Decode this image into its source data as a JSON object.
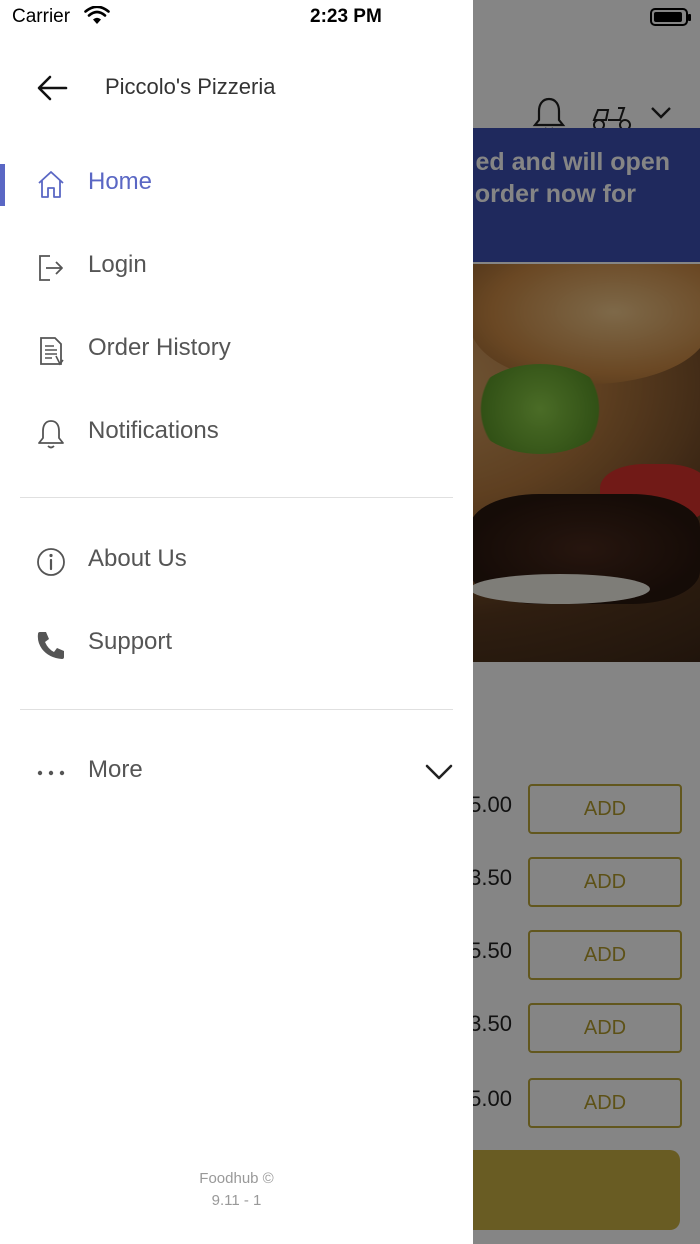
{
  "status_bar": {
    "carrier": "Carrier",
    "time": "2:23 PM"
  },
  "drawer": {
    "title": "Piccolo's Pizzeria",
    "items": [
      {
        "label": "Home",
        "icon": "home-icon",
        "active": true
      },
      {
        "label": "Login",
        "icon": "login-icon",
        "active": false
      },
      {
        "label": "Order History",
        "icon": "order-history-icon",
        "active": false
      },
      {
        "label": "Notifications",
        "icon": "bell-icon",
        "active": false
      },
      {
        "label": "About Us",
        "icon": "info-icon",
        "active": false
      },
      {
        "label": "Support",
        "icon": "phone-icon",
        "active": false
      },
      {
        "label": "More",
        "icon": "ellipsis-icon",
        "active": false
      }
    ],
    "footer": {
      "brand": "Foodhub ©",
      "version": "9.11 - 1"
    },
    "accent_color": "#5a67c4"
  },
  "background": {
    "banner_line1": "ed and will open",
    "banner_line2": "order now for",
    "banner_color": "#3c4fb2",
    "rows": [
      {
        "price": "5.00",
        "button": "ADD"
      },
      {
        "price": "3.50",
        "button": "ADD"
      },
      {
        "price": "5.50",
        "button": "ADD"
      },
      {
        "price": "3.50",
        "button": "ADD"
      },
      {
        "price": "5.00",
        "button": "ADD"
      }
    ]
  }
}
